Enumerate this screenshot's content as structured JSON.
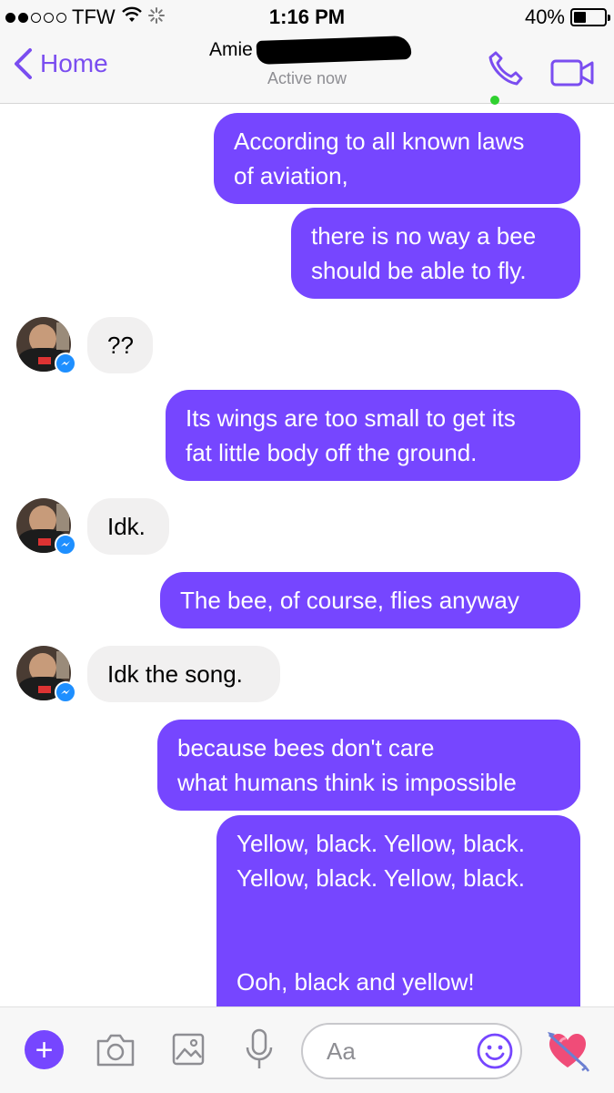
{
  "status_bar": {
    "carrier": "TFW",
    "time": "1:16 PM",
    "battery": "40%",
    "battery_level": 0.4
  },
  "header": {
    "back_label": "Home",
    "contact_name": "Amie",
    "contact_status": "Active now",
    "icons": [
      "phone-icon",
      "video-camera-icon"
    ]
  },
  "messages": [
    {
      "direction": "out",
      "text": "According to all known laws\nof aviation,"
    },
    {
      "direction": "out",
      "text": "there is no way a bee\nshould be able to fly."
    },
    {
      "direction": "in",
      "text": "??"
    },
    {
      "direction": "out",
      "text": "Its wings are too small to get its\nfat little body off the ground."
    },
    {
      "direction": "in",
      "text": "Idk."
    },
    {
      "direction": "out",
      "text": "The bee, of course, flies anyway"
    },
    {
      "direction": "in",
      "text": "Idk the song."
    },
    {
      "direction": "out",
      "text": "because bees don't care\nwhat humans think is impossible"
    },
    {
      "direction": "out",
      "text": "Yellow, black. Yellow, black.\nYellow, black. Yellow, black.\n\n\nOoh, black and yellow!"
    }
  ],
  "composer": {
    "placeholder": "Aa",
    "icons": [
      "plus-icon",
      "camera-icon",
      "photo-icon",
      "microphone-icon",
      "emoji-icon",
      "heart-arrow-icon"
    ]
  },
  "colors": {
    "accent": "#7646ff",
    "incoming_bubble": "#f1f0f0",
    "online": "#2fd12f",
    "messenger_badge": "#1e8fff"
  }
}
